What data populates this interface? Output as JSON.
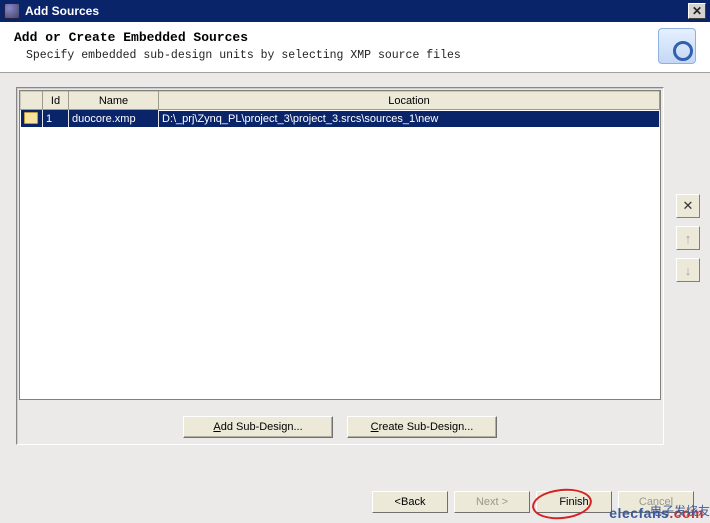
{
  "window": {
    "title": "Add Sources"
  },
  "header": {
    "heading": "Add or Create Embedded Sources",
    "description": "Specify embedded sub-design units by selecting XMP source files"
  },
  "table": {
    "columns": {
      "icon": "",
      "id": "Id",
      "name": "Name",
      "location": "Location"
    },
    "rows": [
      {
        "id": "1",
        "name": "duocore.xmp",
        "location": "D:\\_prj\\Zynq_PL\\project_3\\project_3.srcs\\sources_1\\new"
      }
    ]
  },
  "side": {
    "remove": "✕",
    "up": "↑",
    "down": "↓"
  },
  "buttons": {
    "add_prefix": "A",
    "add_rest": "dd Sub-Design...",
    "create_prefix": "C",
    "create_rest": "reate Sub-Design..."
  },
  "wizard": {
    "back_prefix": "< ",
    "back_u": "B",
    "back_rest": "ack",
    "next_prefix": "",
    "next_u": "N",
    "next_rest": "ext >",
    "finish_prefix": "",
    "finish_u": "F",
    "finish_rest": "inish",
    "cancel": "Cancel"
  },
  "watermark": {
    "brand": "elecfans",
    "tld": ".com",
    "cn": "电子发烧友"
  }
}
